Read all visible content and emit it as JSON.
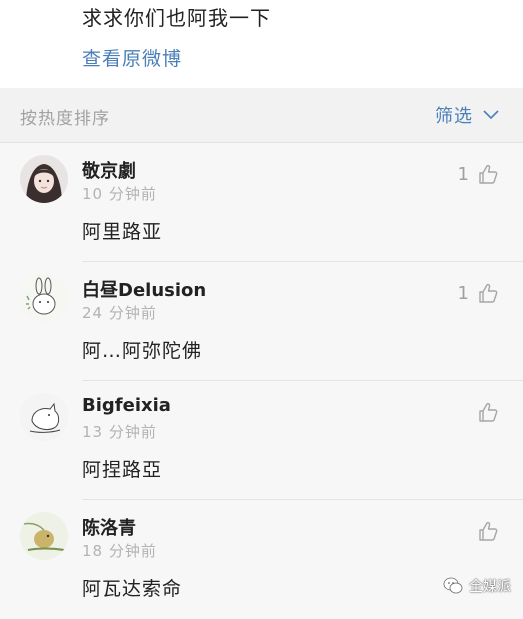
{
  "post": {
    "text": "求求你们也阿我一下",
    "view_original_link": "查看原微博"
  },
  "sortbar": {
    "label": "按热度排序",
    "filter_label": "筛选"
  },
  "comments": [
    {
      "username": "敬京劇",
      "time": "10 分钟前",
      "text": "阿里路亚",
      "likes": "1",
      "avatar": "photo-girl-avatar"
    },
    {
      "username": "白昼Delusion",
      "time": "24 分钟前",
      "text": "阿…阿弥陀佛",
      "likes": "1",
      "avatar": "rabbit-doodle-avatar"
    },
    {
      "username": "Bigfeixia",
      "time": "13 分钟前",
      "text": "阿捏路亞",
      "likes": "",
      "avatar": "cat-doodle-avatar"
    },
    {
      "username": "陈洛青",
      "time": "18 分钟前",
      "text": "阿瓦达索命",
      "likes": "",
      "avatar": "bird-illustration-avatar"
    }
  ],
  "watermark": {
    "text": "全媒派",
    "icon": "wechat-icon"
  },
  "colors": {
    "link_blue": "#4a7fb8",
    "muted_gray": "#b3b3b3",
    "background": "#f7f7f7"
  }
}
